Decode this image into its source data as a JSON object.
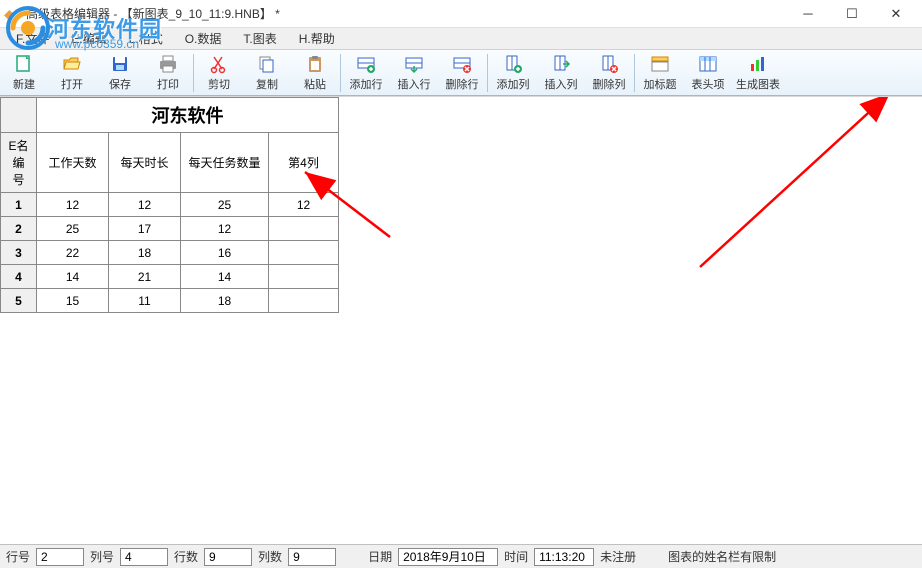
{
  "window": {
    "title": "高级表格编辑器 - 【新图表_9_10_11:9.HNB】 *"
  },
  "watermark": {
    "text": "河东软件园",
    "url": "www.pc0359.cn"
  },
  "menu": {
    "file": "F.文件",
    "edit": "E.编辑",
    "format": "L.格式",
    "data": "O.数据",
    "chart": "T.图表",
    "help": "H.帮助"
  },
  "toolbar": {
    "new": "新建",
    "open": "打开",
    "save": "保存",
    "print": "打印",
    "cut": "剪切",
    "copy": "复制",
    "paste": "粘贴",
    "addRow": "添加行",
    "insertRow": "插入行",
    "deleteRow": "删除行",
    "addCol": "添加列",
    "insertCol": "插入列",
    "deleteCol": "删除列",
    "addTitle": "加标题",
    "headerItem": "表头项",
    "genChart": "生成图表"
  },
  "table": {
    "title": "河东软件",
    "rowHeaderCol": "E名编号",
    "columns": [
      "工作天数",
      "每天时长",
      "每天任务数量",
      "第4列"
    ],
    "rowNumbers": [
      "1",
      "2",
      "3",
      "4",
      "5"
    ],
    "rows": [
      {
        "c1": "12",
        "c2": "12",
        "c3": "25",
        "c4": "12"
      },
      {
        "c1": "25",
        "c2": "17",
        "c3": "12",
        "c4": ""
      },
      {
        "c1": "22",
        "c2": "18",
        "c3": "16",
        "c4": ""
      },
      {
        "c1": "14",
        "c2": "21",
        "c3": "14",
        "c4": ""
      },
      {
        "c1": "15",
        "c2": "11",
        "c3": "18",
        "c4": ""
      }
    ]
  },
  "status": {
    "rowNumLabel": "行号",
    "rowNum": "2",
    "colNumLabel": "列号",
    "colNum": "4",
    "rowCountLabel": "行数",
    "rowCount": "9",
    "colCountLabel": "列数",
    "colCount": "9",
    "dateLabel": "日期",
    "date": "2018年9月10日",
    "timeLabel": "时间",
    "time": "11:13:20",
    "regStatus": "未注册",
    "footerMsg": "图表的姓名栏有限制"
  }
}
